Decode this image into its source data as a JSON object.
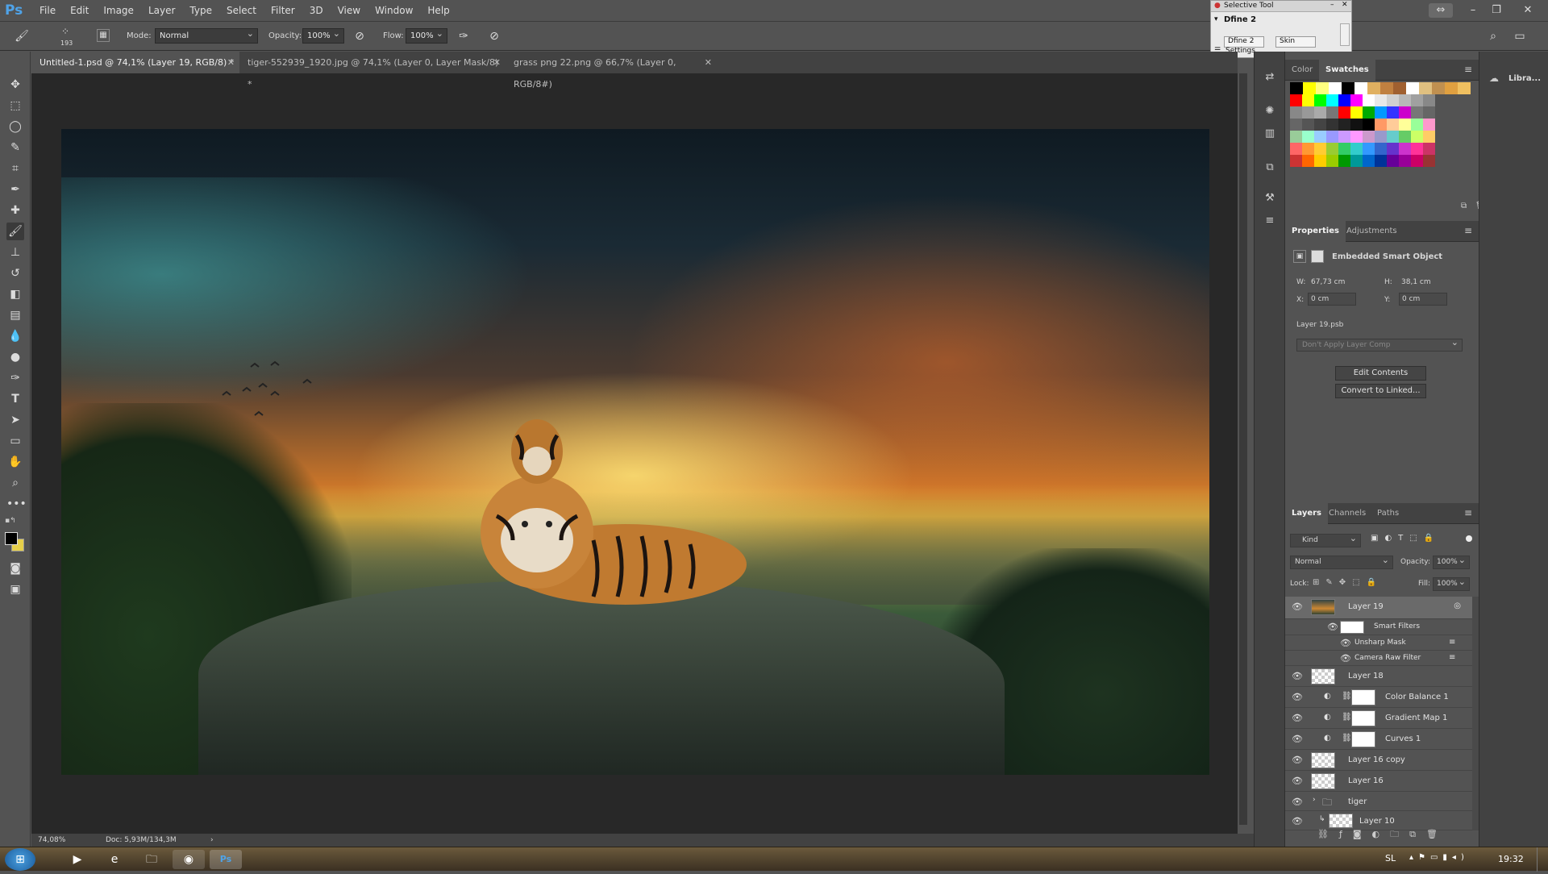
{
  "app": {
    "logo": "Ps",
    "menu": [
      "File",
      "Edit",
      "Image",
      "Layer",
      "Type",
      "Select",
      "Filter",
      "3D",
      "View",
      "Window",
      "Help"
    ]
  },
  "options": {
    "brush_size": "193",
    "mode_label": "Mode:",
    "mode_value": "Normal",
    "opacity_label": "Opacity:",
    "opacity_value": "100%",
    "flow_label": "Flow:",
    "flow_value": "100%"
  },
  "tabs": [
    {
      "label": "Untitled-1.psd @ 74,1% (Layer 19, RGB/8) *"
    },
    {
      "label": "tiger-552939_1920.jpg @ 74,1% (Layer 0, Layer Mask/8) *"
    },
    {
      "label": "grass png 22.png @ 66,7% (Layer 0, RGB/8#)"
    }
  ],
  "dfine": {
    "title": "Selective Tool",
    "heading": "Dfine 2",
    "item1": "Dfine 2",
    "item2": "Skin",
    "settings": "Settings"
  },
  "color_panel": {
    "tab_color": "Color",
    "tab_swatches": "Swatches"
  },
  "properties": {
    "tab_properties": "Properties",
    "tab_adjustments": "Adjustments",
    "type": "Embedded Smart Object",
    "w_label": "W:",
    "w_value": "67,73 cm",
    "h_label": "H:",
    "h_value": "38,1 cm",
    "x_label": "X:",
    "x_value": "0 cm",
    "y_label": "Y:",
    "y_value": "0 cm",
    "file": "Layer 19.psb",
    "layer_comp": "Don't Apply Layer Comp",
    "edit_contents": "Edit Contents",
    "convert": "Convert to Linked..."
  },
  "layers_panel": {
    "tab_layers": "Layers",
    "tab_channels": "Channels",
    "tab_paths": "Paths",
    "kind": "Kind",
    "blend": "Normal",
    "opacity_label": "Opacity:",
    "opacity_value": "100%",
    "lock_label": "Lock:",
    "fill_label": "Fill:",
    "fill_value": "100%",
    "layers": [
      {
        "name": "Layer 19"
      },
      {
        "name": "Smart Filters"
      },
      {
        "name": "Unsharp Mask"
      },
      {
        "name": "Camera Raw Filter"
      },
      {
        "name": "Layer 18"
      },
      {
        "name": "Color Balance 1"
      },
      {
        "name": "Gradient Map 1"
      },
      {
        "name": "Curves 1"
      },
      {
        "name": "Layer 16 copy"
      },
      {
        "name": "Layer 16"
      },
      {
        "name": "tiger"
      },
      {
        "name": "Layer 10"
      }
    ]
  },
  "libraries": {
    "label": "Libra..."
  },
  "status": {
    "zoom": "74,08%",
    "doc": "Doc: 5,93M/134,3M"
  },
  "taskbar": {
    "lang": "SL",
    "time": "19:32"
  },
  "colors": {
    "accent": "#4fa3e8",
    "panel": "#535353",
    "dark": "#282828"
  }
}
